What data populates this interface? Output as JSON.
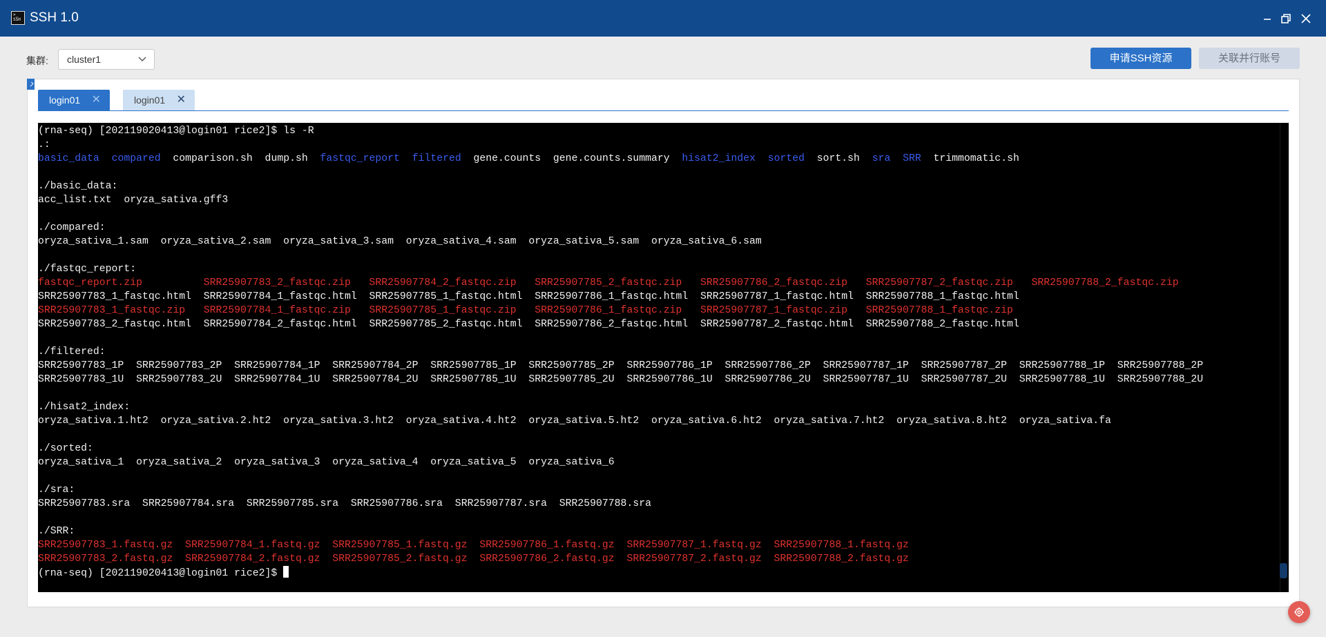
{
  "window": {
    "app_icon_text": ">_\nSSH",
    "title": "SSH 1.0",
    "minimize_icon": "minimize-icon",
    "maximize_icon": "restore-icon",
    "close_icon": "close-icon"
  },
  "toolbar": {
    "cluster_label": "集群:",
    "cluster_value": "cluster1",
    "apply_ssh_label": "申请SSH资源",
    "link_account_label": "关联并行账号"
  },
  "tabs": [
    {
      "label": "login01",
      "active": true
    },
    {
      "label": "login01",
      "active": false
    }
  ],
  "colors": {
    "titlebar": "#114a8d",
    "accent": "#2b72c8",
    "terminal_bg": "#000000",
    "dir_blue": "#3a5cf0",
    "archive_red": "#e0332f"
  },
  "terminal": {
    "lines": [
      [
        {
          "t": "(rna-seq) [202119020413@login01 rice2]$ ls -R",
          "c": "white"
        }
      ],
      [
        {
          "t": ".:",
          "c": "white"
        }
      ],
      [
        {
          "t": "basic_data",
          "c": "blue"
        },
        {
          "t": "  ",
          "c": "white"
        },
        {
          "t": "compared",
          "c": "blue"
        },
        {
          "t": "  comparison.sh  dump.sh  ",
          "c": "white"
        },
        {
          "t": "fastqc_report",
          "c": "blue"
        },
        {
          "t": "  ",
          "c": "white"
        },
        {
          "t": "filtered",
          "c": "blue"
        },
        {
          "t": "  gene.counts  gene.counts.summary  ",
          "c": "white"
        },
        {
          "t": "hisat2_index",
          "c": "blue"
        },
        {
          "t": "  ",
          "c": "white"
        },
        {
          "t": "sorted",
          "c": "blue"
        },
        {
          "t": "  sort.sh  ",
          "c": "white"
        },
        {
          "t": "sra",
          "c": "blue"
        },
        {
          "t": "  ",
          "c": "white"
        },
        {
          "t": "SRR",
          "c": "blue"
        },
        {
          "t": "  trimmomatic.sh",
          "c": "white"
        }
      ],
      [
        {
          "t": "",
          "c": "white"
        }
      ],
      [
        {
          "t": "./basic_data:",
          "c": "white"
        }
      ],
      [
        {
          "t": "acc_list.txt  oryza_sativa.gff3",
          "c": "white"
        }
      ],
      [
        {
          "t": "",
          "c": "white"
        }
      ],
      [
        {
          "t": "./compared:",
          "c": "white"
        }
      ],
      [
        {
          "t": "oryza_sativa_1.sam  oryza_sativa_2.sam  oryza_sativa_3.sam  oryza_sativa_4.sam  oryza_sativa_5.sam  oryza_sativa_6.sam",
          "c": "white"
        }
      ],
      [
        {
          "t": "",
          "c": "white"
        }
      ],
      [
        {
          "t": "./fastqc_report:",
          "c": "white"
        }
      ],
      [
        {
          "t": "fastqc_report.zip          SRR25907783_2_fastqc.zip   SRR25907784_2_fastqc.zip   SRR25907785_2_fastqc.zip   SRR25907786_2_fastqc.zip   SRR25907787_2_fastqc.zip   SRR25907788_2_fastqc.zip",
          "c": "red"
        }
      ],
      [
        {
          "t": "SRR25907783_1_fastqc.html  SRR25907784_1_fastqc.html  SRR25907785_1_fastqc.html  SRR25907786_1_fastqc.html  SRR25907787_1_fastqc.html  SRR25907788_1_fastqc.html",
          "c": "white"
        }
      ],
      [
        {
          "t": "SRR25907783_1_fastqc.zip   SRR25907784_1_fastqc.zip   SRR25907785_1_fastqc.zip   SRR25907786_1_fastqc.zip   SRR25907787_1_fastqc.zip   SRR25907788_1_fastqc.zip",
          "c": "red"
        }
      ],
      [
        {
          "t": "SRR25907783_2_fastqc.html  SRR25907784_2_fastqc.html  SRR25907785_2_fastqc.html  SRR25907786_2_fastqc.html  SRR25907787_2_fastqc.html  SRR25907788_2_fastqc.html",
          "c": "white"
        }
      ],
      [
        {
          "t": "",
          "c": "white"
        }
      ],
      [
        {
          "t": "./filtered:",
          "c": "white"
        }
      ],
      [
        {
          "t": "SRR25907783_1P  SRR25907783_2P  SRR25907784_1P  SRR25907784_2P  SRR25907785_1P  SRR25907785_2P  SRR25907786_1P  SRR25907786_2P  SRR25907787_1P  SRR25907787_2P  SRR25907788_1P  SRR25907788_2P",
          "c": "white"
        }
      ],
      [
        {
          "t": "SRR25907783_1U  SRR25907783_2U  SRR25907784_1U  SRR25907784_2U  SRR25907785_1U  SRR25907785_2U  SRR25907786_1U  SRR25907786_2U  SRR25907787_1U  SRR25907787_2U  SRR25907788_1U  SRR25907788_2U",
          "c": "white"
        }
      ],
      [
        {
          "t": "",
          "c": "white"
        }
      ],
      [
        {
          "t": "./hisat2_index:",
          "c": "white"
        }
      ],
      [
        {
          "t": "oryza_sativa.1.ht2  oryza_sativa.2.ht2  oryza_sativa.3.ht2  oryza_sativa.4.ht2  oryza_sativa.5.ht2  oryza_sativa.6.ht2  oryza_sativa.7.ht2  oryza_sativa.8.ht2  oryza_sativa.fa",
          "c": "white"
        }
      ],
      [
        {
          "t": "",
          "c": "white"
        }
      ],
      [
        {
          "t": "./sorted:",
          "c": "white"
        }
      ],
      [
        {
          "t": "oryza_sativa_1  oryza_sativa_2  oryza_sativa_3  oryza_sativa_4  oryza_sativa_5  oryza_sativa_6",
          "c": "white"
        }
      ],
      [
        {
          "t": "",
          "c": "white"
        }
      ],
      [
        {
          "t": "./sra:",
          "c": "white"
        }
      ],
      [
        {
          "t": "SRR25907783.sra  SRR25907784.sra  SRR25907785.sra  SRR25907786.sra  SRR25907787.sra  SRR25907788.sra",
          "c": "white"
        }
      ],
      [
        {
          "t": "",
          "c": "white"
        }
      ],
      [
        {
          "t": "./SRR:",
          "c": "white"
        }
      ],
      [
        {
          "t": "SRR25907783_1.fastq.gz  SRR25907784_1.fastq.gz  SRR25907785_1.fastq.gz  SRR25907786_1.fastq.gz  SRR25907787_1.fastq.gz  SRR25907788_1.fastq.gz",
          "c": "red"
        }
      ],
      [
        {
          "t": "SRR25907783_2.fastq.gz  SRR25907784_2.fastq.gz  SRR25907785_2.fastq.gz  SRR25907786_2.fastq.gz  SRR25907787_2.fastq.gz  SRR25907788_2.fastq.gz",
          "c": "red"
        }
      ],
      [
        {
          "t": "(rna-seq) [202119020413@login01 rice2]$ ",
          "c": "white"
        }
      ]
    ]
  },
  "fab_icon": "settings-icon"
}
